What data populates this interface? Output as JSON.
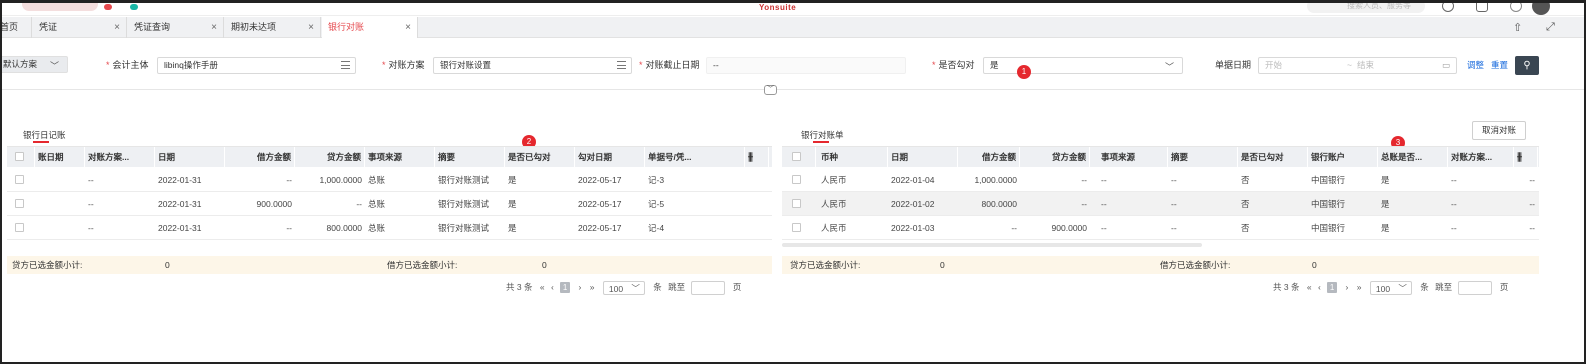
{
  "topbar": {
    "brand": "Yonsuite",
    "search_placeholder": "搜索人员、服务等"
  },
  "tabs": [
    {
      "label": "首页"
    },
    {
      "label": "凭证"
    },
    {
      "label": "凭证查询"
    },
    {
      "label": "期初未达项"
    },
    {
      "label": "银行对账"
    }
  ],
  "filter": {
    "scheme_value": "默认方案",
    "entity_label": "会计主体",
    "entity_value": "libinq操作手册",
    "plan_label": "对账方案",
    "plan_value": "银行对账设置",
    "cutoff_label": "对账截止日期",
    "cutoff_value": "--",
    "checked_label": "是否勾对",
    "checked_value": "是",
    "docdate_label": "单据日期",
    "start_placeholder": "开始",
    "end_placeholder": "结束",
    "tilde": "~",
    "adjust_link": "调整",
    "reset_link": "重置",
    "badge1": "1"
  },
  "left": {
    "title": "银行日记账",
    "badge": "2",
    "columns": [
      "账日期",
      "对账方案...",
      "日期",
      "借方金额",
      "贷方金额",
      "事项来源",
      "摘要",
      "是否已勾对",
      "勾对日期",
      "单据号/凭..."
    ],
    "rows": [
      [
        "",
        "--",
        "2022-01-31",
        "--",
        "1,000.0000",
        "总账",
        "银行对账测试",
        "是",
        "2022-05-17",
        "记-3"
      ],
      [
        "",
        "--",
        "2022-01-31",
        "900.0000",
        "--",
        "总账",
        "银行对账测试",
        "是",
        "2022-05-17",
        "记-5"
      ],
      [
        "",
        "--",
        "2022-01-31",
        "--",
        "800.0000",
        "总账",
        "银行对账测试",
        "是",
        "2022-05-17",
        "记-4"
      ]
    ],
    "credit_subtotal_label": "贷方已选金额小计:",
    "credit_subtotal": "0",
    "debit_subtotal_label": "借方已选金额小计:",
    "debit_subtotal": "0",
    "total": "共 3 条",
    "page": "1",
    "page_size": "100",
    "unit": "条",
    "jump": "跳至",
    "page_word": "页"
  },
  "right": {
    "title": "银行对账单",
    "badge": "3",
    "cancel_btn": "取消对账",
    "columns": [
      "币种",
      "日期",
      "借方金额",
      "贷方金额",
      "事项来源",
      "摘要",
      "是否已勾对",
      "银行账户",
      "总账是否...",
      "对账方案..."
    ],
    "rows": [
      [
        "人民币",
        "2022-01-04",
        "1,000.0000",
        "--",
        "--",
        "--",
        "否",
        "中国银行",
        "是",
        "--",
        "--"
      ],
      [
        "人民币",
        "2022-01-02",
        "800.0000",
        "--",
        "--",
        "--",
        "否",
        "中国银行",
        "是",
        "--",
        "--"
      ],
      [
        "人民币",
        "2022-01-03",
        "--",
        "900.0000",
        "--",
        "--",
        "否",
        "中国银行",
        "是",
        "--",
        "--"
      ]
    ],
    "credit_subtotal_label": "贷方已选金额小计:",
    "credit_subtotal": "0",
    "debit_subtotal_label": "借方已选金额小计:",
    "debit_subtotal": "0",
    "total": "共 3 条",
    "page": "1",
    "page_size": "100",
    "unit": "条",
    "jump": "跳至",
    "page_word": "页"
  }
}
